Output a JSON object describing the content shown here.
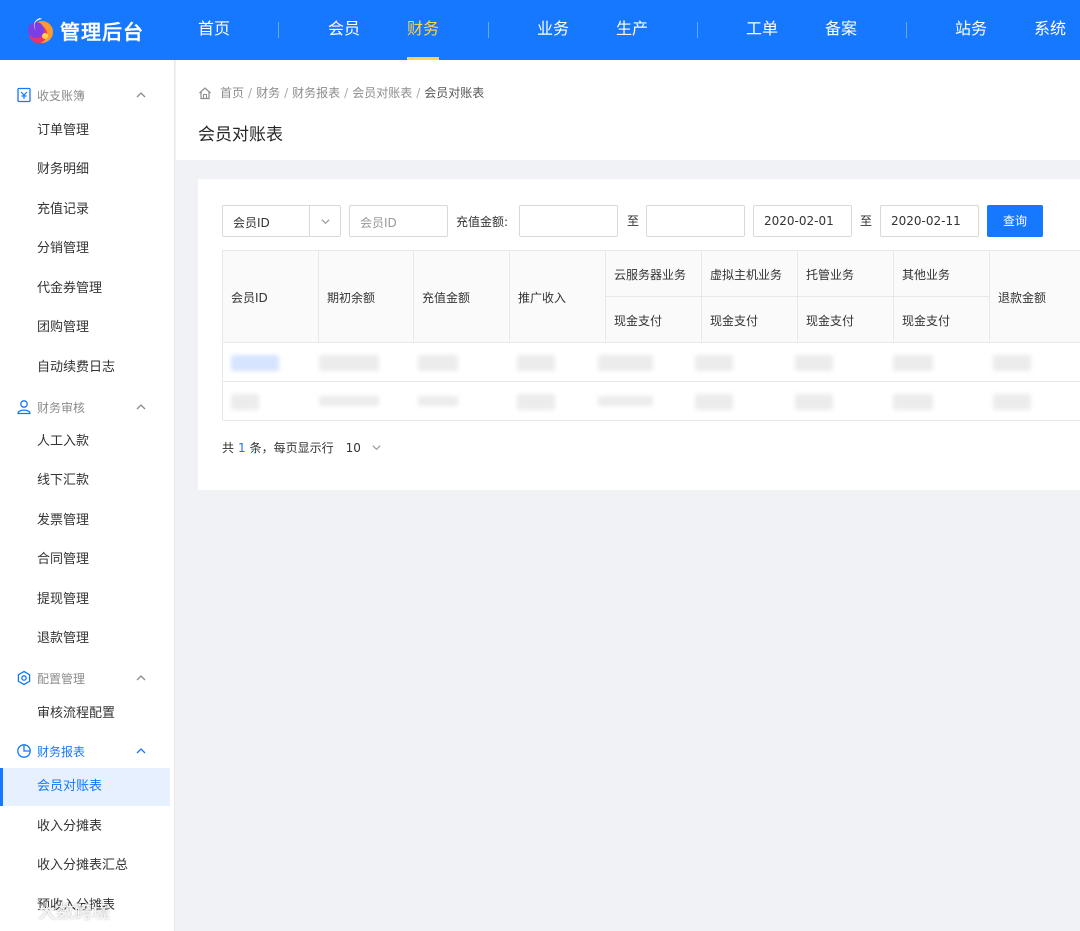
{
  "header": {
    "app_title": "管理后台",
    "nav": [
      "首页",
      "会员",
      "财务",
      "业务",
      "生产",
      "工单",
      "备案",
      "站务",
      "系统"
    ],
    "active_nav": "财务",
    "accent_color": "#1677ff",
    "active_color": "#ffd34d"
  },
  "sidebar": {
    "groups": [
      {
        "label": "收支账簿",
        "icon": "ledger-icon",
        "items": [
          "订单管理",
          "财务明细",
          "充值记录",
          "分销管理",
          "代金券管理",
          "团购管理",
          "自动续费日志"
        ]
      },
      {
        "label": "财务审核",
        "icon": "user-audit-icon",
        "items": [
          "人工入款",
          "线下汇款",
          "发票管理",
          "合同管理",
          "提现管理",
          "退款管理"
        ]
      },
      {
        "label": "配置管理",
        "icon": "settings-hex-icon",
        "items": [
          "审核流程配置"
        ]
      },
      {
        "label": "财务报表",
        "icon": "pie-chart-icon",
        "items": [
          "会员对账表",
          "收入分摊表",
          "收入分摊表汇总",
          "预收入分摊表"
        ]
      }
    ],
    "active_item": "会员对账表"
  },
  "breadcrumb": [
    "首页",
    "财务",
    "财务报表",
    "会员对账表",
    "会员对账表"
  ],
  "page_title": "会员对账表",
  "filters": {
    "select_value": "会员ID",
    "member_id_placeholder": "会员ID",
    "amount_label": "充值金额:",
    "to_label": "至",
    "date_start": "2020-02-01",
    "date_end": "2020-02-11",
    "query_button": "查询"
  },
  "table": {
    "headers": [
      "会员ID",
      "期初余额",
      "充值金额",
      "推广收入",
      "云服务器业务",
      "虚拟主机业务",
      "托管业务",
      "其他业务",
      "退款金额"
    ],
    "sub_header": "现金支付",
    "rows_obscured": 2
  },
  "pagination": {
    "prefix": "共",
    "total": "1",
    "suffix": "条，每页显示行",
    "page_size": "10"
  },
  "watermark": "大数跨境"
}
